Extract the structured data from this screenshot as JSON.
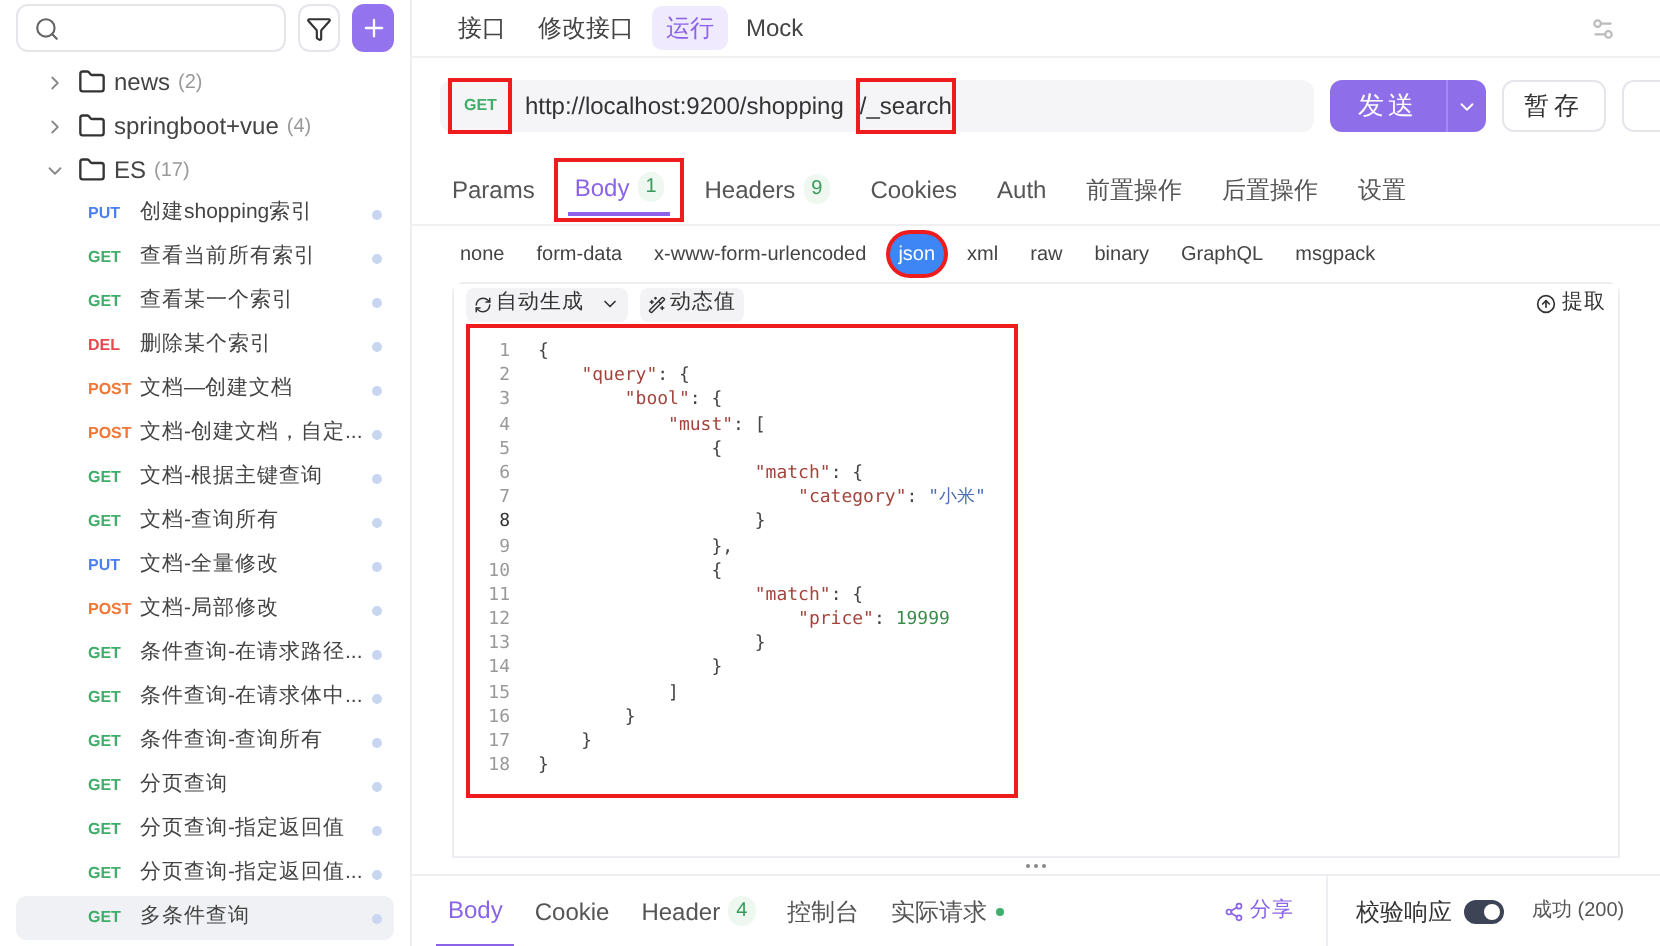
{
  "sidebar": {
    "tree": [
      {
        "name": "news",
        "count": "(2)",
        "expanded": false
      },
      {
        "name": "springboot+vue",
        "count": "(4)",
        "expanded": false
      },
      {
        "name": "ES",
        "count": "(17)",
        "expanded": true,
        "children": [
          {
            "method": "PUT",
            "name": "创建shopping索引",
            "selected": false
          },
          {
            "method": "GET",
            "name": "查看当前所有索引",
            "selected": false
          },
          {
            "method": "GET",
            "name": "查看某一个索引",
            "selected": false
          },
          {
            "method": "DEL",
            "name": "删除某个索引",
            "selected": false
          },
          {
            "method": "POST",
            "name": "文档—创建文档",
            "selected": false
          },
          {
            "method": "POST",
            "name": "文档-创建文档，自定...",
            "selected": false
          },
          {
            "method": "GET",
            "name": "文档-根据主键查询",
            "selected": false
          },
          {
            "method": "GET",
            "name": "文档-查询所有",
            "selected": false
          },
          {
            "method": "PUT",
            "name": "文档-全量修改",
            "selected": false
          },
          {
            "method": "POST",
            "name": "文档-局部修改",
            "selected": false
          },
          {
            "method": "GET",
            "name": "条件查询-在请求路径...",
            "selected": false
          },
          {
            "method": "GET",
            "name": "条件查询-在请求体中...",
            "selected": false
          },
          {
            "method": "GET",
            "name": "条件查询-查询所有",
            "selected": false
          },
          {
            "method": "GET",
            "name": "分页查询",
            "selected": false
          },
          {
            "method": "GET",
            "name": "分页查询-指定返回值",
            "selected": false
          },
          {
            "method": "GET",
            "name": "分页查询-指定返回值...",
            "selected": false
          },
          {
            "method": "GET",
            "name": "多条件查询",
            "selected": true
          }
        ]
      }
    ]
  },
  "top_tabs": [
    {
      "label": "接口",
      "selected": false
    },
    {
      "label": "修改接口",
      "selected": false
    },
    {
      "label": "运行",
      "selected": true
    },
    {
      "label": "Mock",
      "selected": false
    }
  ],
  "request": {
    "method": "GET",
    "method_highlighted": true,
    "url_parts": [
      {
        "text": "http://localhost:9200/shopping",
        "highlighted": false
      },
      {
        "text": "/_search",
        "highlighted": true
      }
    ],
    "send": "发送",
    "save": "暂存"
  },
  "request_tabs": [
    {
      "label": "Params",
      "selected": false,
      "highlighted": false
    },
    {
      "label": "Body",
      "count": "1",
      "selected": true,
      "highlighted": true
    },
    {
      "label": "Headers",
      "count": "9",
      "selected": false,
      "highlighted": false
    },
    {
      "label": "Cookies",
      "selected": false,
      "highlighted": false
    },
    {
      "label": "Auth",
      "selected": false,
      "highlighted": false
    },
    {
      "label": "前置操作",
      "selected": false,
      "highlighted": false
    },
    {
      "label": "后置操作",
      "selected": false,
      "highlighted": false
    },
    {
      "label": "设置",
      "selected": false,
      "highlighted": false
    }
  ],
  "body_types": [
    {
      "label": "none",
      "selected": false,
      "highlighted": false
    },
    {
      "label": "form-data",
      "selected": false,
      "highlighted": false
    },
    {
      "label": "x-www-form-urlencoded",
      "selected": false,
      "highlighted": false
    },
    {
      "label": "json",
      "selected": true,
      "highlighted": true
    },
    {
      "label": "xml",
      "selected": false,
      "highlighted": false
    },
    {
      "label": "raw",
      "selected": false,
      "highlighted": false
    },
    {
      "label": "binary",
      "selected": false,
      "highlighted": false
    },
    {
      "label": "GraphQL",
      "selected": false,
      "highlighted": false
    },
    {
      "label": "msgpack",
      "selected": false,
      "highlighted": false
    }
  ],
  "editor_toolbar": {
    "auto_generate": "自动生成",
    "dynamic_value": "动态值",
    "extract": "提取"
  },
  "editor": {
    "highlighted": true,
    "lines": [
      {
        "num": "1",
        "code": "{",
        "active": false
      },
      {
        "num": "2",
        "code": "    \"query\": {",
        "active": false
      },
      {
        "num": "3",
        "code": "        \"bool\": {",
        "active": false
      },
      {
        "num": "4",
        "code": "            \"must\": [",
        "active": false
      },
      {
        "num": "5",
        "code": "                {",
        "active": false
      },
      {
        "num": "6",
        "code": "                    \"match\": {",
        "active": false
      },
      {
        "num": "7",
        "code": "                        \"category\": \"小米\"",
        "active": false
      },
      {
        "num": "8",
        "code": "                    }",
        "active": true
      },
      {
        "num": "9",
        "code": "                },",
        "active": false
      },
      {
        "num": "10",
        "code": "                {",
        "active": false
      },
      {
        "num": "11",
        "code": "                    \"match\": {",
        "active": false
      },
      {
        "num": "12",
        "code": "                        \"price\": 19999",
        "active": false
      },
      {
        "num": "13",
        "code": "                    }",
        "active": false
      },
      {
        "num": "14",
        "code": "                }",
        "active": false
      },
      {
        "num": "15",
        "code": "            ]",
        "active": false
      },
      {
        "num": "16",
        "code": "        }",
        "active": false
      },
      {
        "num": "17",
        "code": "    }",
        "active": false
      },
      {
        "num": "18",
        "code": "}",
        "active": false
      }
    ]
  },
  "response_tabs": [
    {
      "label": "Body",
      "dot": false,
      "selected": true
    },
    {
      "label": "Cookie",
      "dot": false,
      "selected": false
    },
    {
      "label": "Header",
      "count": "4",
      "dot": false,
      "selected": false
    },
    {
      "label": "控制台",
      "dot": false,
      "selected": false
    },
    {
      "label": "实际请求",
      "dot": true,
      "selected": false
    }
  ],
  "share": "分享",
  "validate": {
    "label": "校验响应",
    "on": true
  },
  "status": "成功 (200)"
}
